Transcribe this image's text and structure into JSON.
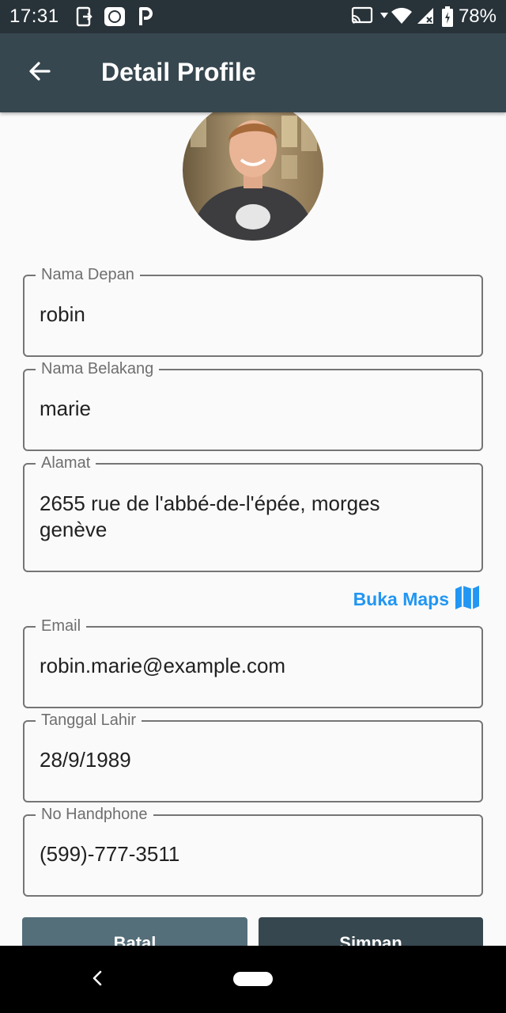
{
  "status_bar": {
    "time": "17:31",
    "battery_percent": "78%",
    "icons": [
      "sim-add-icon",
      "news-app-icon",
      "paypal-icon",
      "cast-icon",
      "wifi-icon",
      "cell-signal-icon",
      "battery-charging-icon"
    ]
  },
  "app_bar": {
    "title": "Detail Profile",
    "back_icon": "arrow-back-icon"
  },
  "profile": {
    "avatar": "avatar-photo"
  },
  "form": {
    "first_name": {
      "label": "Nama Depan",
      "value": "robin"
    },
    "last_name": {
      "label": "Nama Belakang",
      "value": "marie"
    },
    "address": {
      "label": "Alamat",
      "value": "2655 rue de l'abbé-de-l'épée, morges genève"
    },
    "open_maps": {
      "label": "Buka Maps",
      "icon": "map-icon"
    },
    "email": {
      "label": "Email",
      "value": "robin.marie@example.com"
    },
    "birth_date": {
      "label": "Tanggal Lahir",
      "value": "28/9/1989"
    },
    "phone": {
      "label": "No Handphone",
      "value": "(599)-777-3511"
    }
  },
  "actions": {
    "cancel_label": "Batal",
    "save_label": "Simpan"
  },
  "colors": {
    "status_bar": "#283339",
    "app_bar": "#37474f",
    "cancel_button": "#546e7a",
    "save_button": "#37474f",
    "link": "#2196f3"
  }
}
